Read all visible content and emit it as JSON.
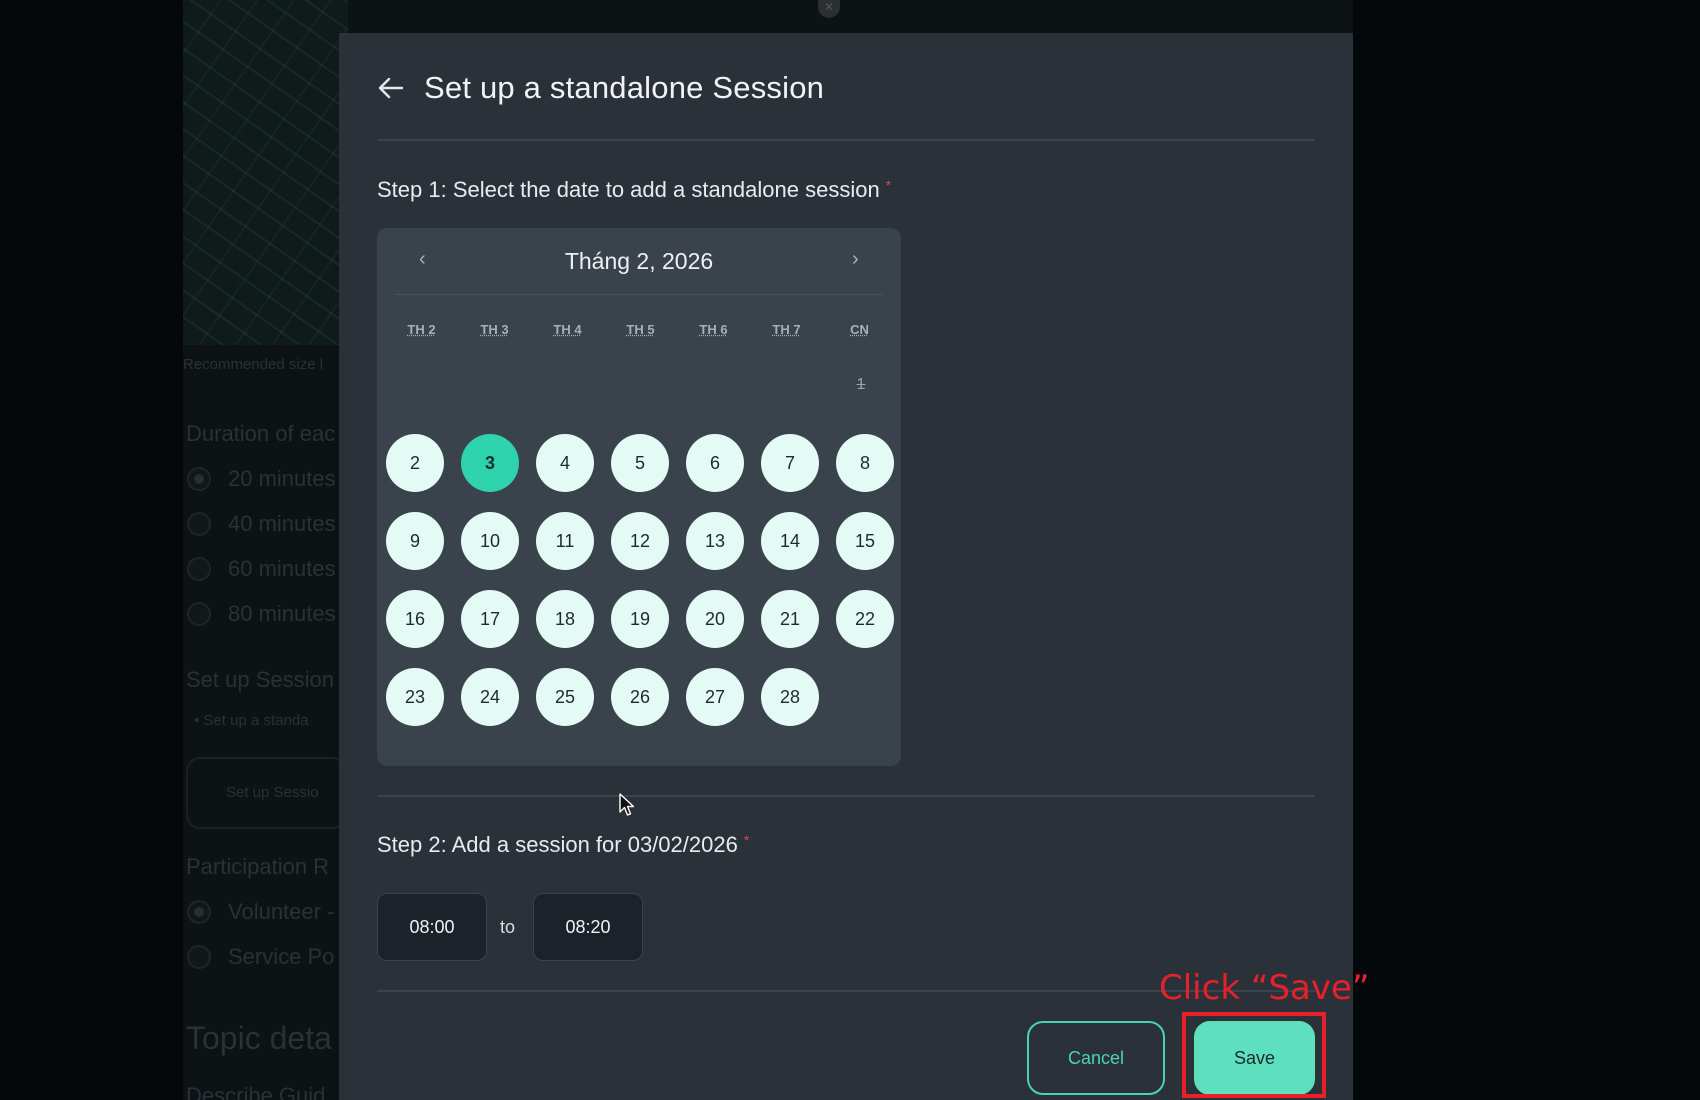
{
  "background": {
    "recommended_size": "Recommended size l",
    "duration_heading": "Duration of eac",
    "duration_options": [
      "20 minutes",
      "40 minutes",
      "60 minutes",
      "80 minutes"
    ],
    "session_heading": "Set up Session",
    "session_bullet": "• Set up a standa",
    "session_button": "Set up Sessio",
    "participation_heading": "Participation R",
    "participation_options": [
      "Volunteer -",
      "Service Po"
    ],
    "topic_heading": "Topic deta",
    "describe_label": "Describe Guid"
  },
  "modal": {
    "title": "Set up a standalone Session",
    "step1_label": "Step 1: Select the date to add a standalone session",
    "step2_label": "Step 2: Add a session for 03/02/2026",
    "required_mark": "*"
  },
  "calendar": {
    "month_label": "Tháng 2, 2026",
    "prev": "‹",
    "next": "›",
    "weekdays": [
      "TH 2",
      "TH 3",
      "TH 4",
      "TH 5",
      "TH 6",
      "TH 7",
      "CN"
    ],
    "disabled_days": [
      "1"
    ],
    "days": [
      "2",
      "3",
      "4",
      "5",
      "6",
      "7",
      "8",
      "9",
      "10",
      "11",
      "12",
      "13",
      "14",
      "15",
      "16",
      "17",
      "18",
      "19",
      "20",
      "21",
      "22",
      "23",
      "24",
      "25",
      "26",
      "27",
      "28"
    ],
    "selected_day": "3"
  },
  "time": {
    "from": "08:00",
    "separator": "to",
    "to": "08:20"
  },
  "buttons": {
    "cancel": "Cancel",
    "save": "Save"
  },
  "annotation": {
    "text": "Click “Save”",
    "color": "#e8202a"
  },
  "colors": {
    "accent": "#2ed3ad",
    "day_bg": "#e3fbf4",
    "modal_bg": "#2b3139"
  }
}
